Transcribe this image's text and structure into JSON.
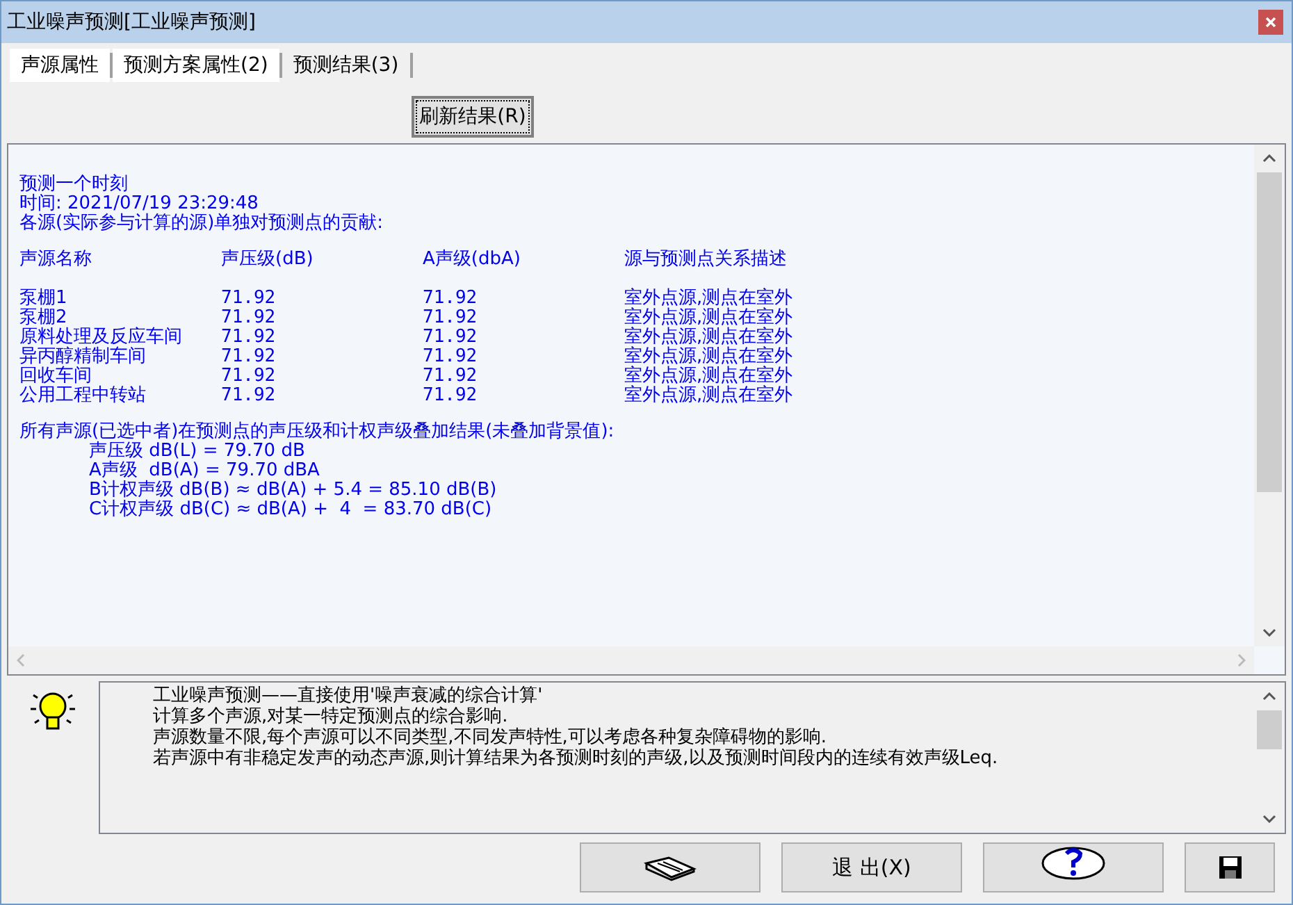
{
  "window": {
    "title": "工业噪声预测[工业噪声预测]"
  },
  "tabs": [
    {
      "label": "声源属性",
      "selected": false
    },
    {
      "label": "预测方案属性(2)",
      "selected": false
    },
    {
      "label": "预测结果(3)",
      "selected": true
    }
  ],
  "refresh_button": "刷新结果(R)",
  "report": {
    "intro": [
      "预测一个时刻",
      "时间: 2021/07/19 23:29:48",
      "各源(实际参与计算的源)单独对预测点的贡献:"
    ],
    "columns": [
      "声源名称",
      "声压级(dB)",
      "A声级(dbA)",
      "源与预测点关系描述"
    ],
    "rows": [
      {
        "name": "泵棚1",
        "spl": "71.92",
        "a_level": "71.92",
        "relation": "室外点源,测点在室外"
      },
      {
        "name": "泵棚2",
        "spl": "71.92",
        "a_level": "71.92",
        "relation": "室外点源,测点在室外"
      },
      {
        "name": "原料处理及反应车间",
        "spl": "71.92",
        "a_level": "71.92",
        "relation": "室外点源,测点在室外"
      },
      {
        "name": "异丙醇精制车间",
        "spl": "71.92",
        "a_level": "71.92",
        "relation": "室外点源,测点在室外"
      },
      {
        "name": "回收车间",
        "spl": "71.92",
        "a_level": "71.92",
        "relation": "室外点源,测点在室外"
      },
      {
        "name": "公用工程中转站",
        "spl": "71.92",
        "a_level": "71.92",
        "relation": "室外点源,测点在室外"
      }
    ],
    "summary_title": "所有声源(已选中者)在预测点的声压级和计权声级叠加结果(未叠加背景值):",
    "summary": [
      "声压级 dB(L) = 79.70 dB",
      "A声级  dB(A) = 79.70 dBA",
      "B计权声级 dB(B) ≈ dB(A) + 5.4 = 85.10 dB(B)",
      "C计权声级 dB(C) ≈ dB(A) +  4  = 83.70 dB(C)"
    ]
  },
  "help": {
    "paragraphs": [
      "工业噪声预测——直接使用'噪声衰减的综合计算'",
      "计算多个声源,对某一特定预测点的综合影响.",
      "声源数量不限,每个声源可以不同类型,不同发声特性,可以考虑各种复杂障碍物的影响.",
      "若声源中有非稳定发声的动态声源,则计算结果为各预测时刻的声级,以及预测时间段内的连续有效声级Leq."
    ]
  },
  "footer_buttons": [
    {
      "kind": "book"
    },
    {
      "kind": "text",
      "label": "退 出(X)"
    },
    {
      "kind": "help"
    },
    {
      "kind": "save"
    }
  ]
}
